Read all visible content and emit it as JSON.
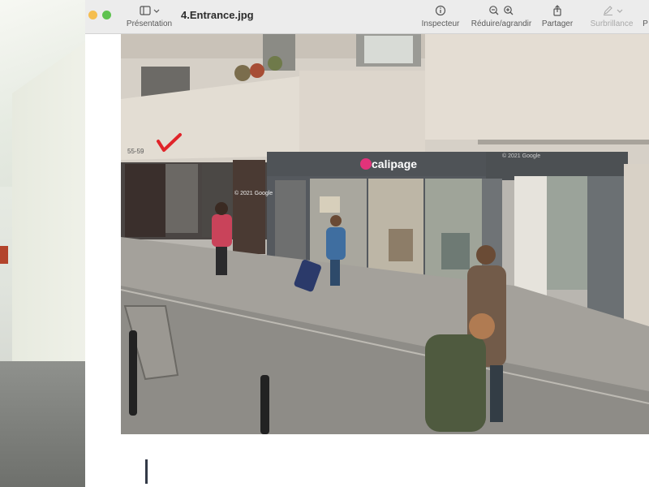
{
  "window": {
    "title": "4.Entrance.jpg"
  },
  "toolbar": {
    "sidebar_label": "Présentation",
    "inspector_label": "Inspecteur",
    "zoom_label": "Réduire/agrandir",
    "share_label": "Partager",
    "highlight_label": "Surbrillance",
    "overflow_label": "P"
  },
  "photo": {
    "shop_sign": "calipage",
    "street_number": "55-59",
    "watermark": "© 2021 Google",
    "watermark_2": "© 2021 Google",
    "colors": {
      "checkmark": "#e0242a",
      "shop_logo": "#e2337a",
      "storefront": "#55595e"
    }
  },
  "icons": {
    "sidebar": "sidebar-icon",
    "inspector": "info-icon",
    "zoom_out": "zoom-out-icon",
    "zoom_in": "zoom-in-icon",
    "share": "share-icon",
    "highlight": "pen-icon"
  }
}
